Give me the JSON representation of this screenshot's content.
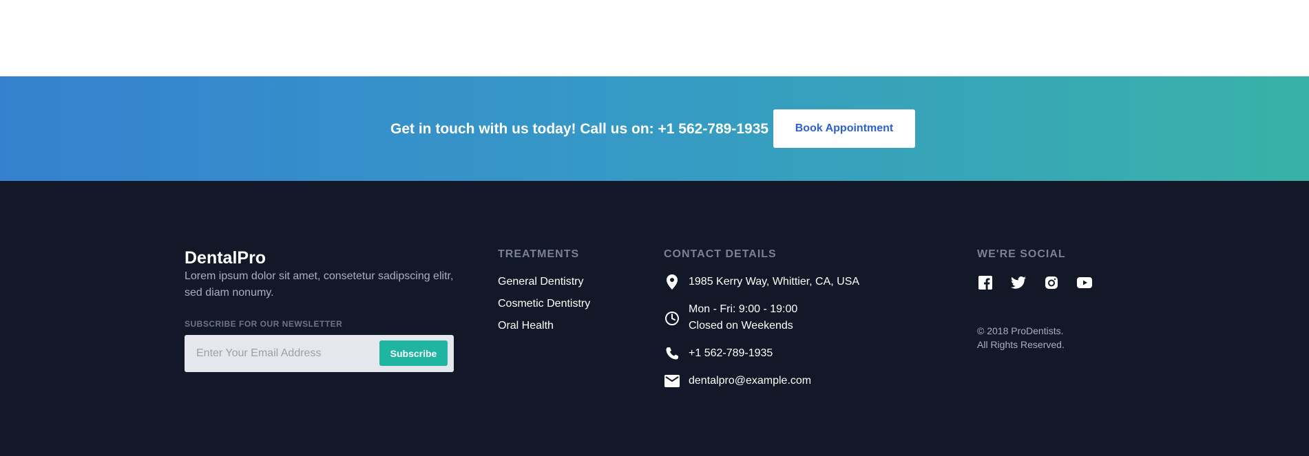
{
  "cta": {
    "text": "Get in touch with us today! Call us on: +1 562-789-1935",
    "button_label": "Book Appointment"
  },
  "brand": {
    "name": "DentalPro",
    "description": "Lorem ipsum dolor sit amet, consetetur sadipscing elitr, sed diam nonumy."
  },
  "newsletter": {
    "label": "SUBSCRIBE FOR OUR NEWSLETTER",
    "placeholder": "Enter Your Email Address",
    "button_label": "Subscribe"
  },
  "treatments": {
    "heading": "TREATMENTS",
    "items": [
      "General Dentistry",
      "Cosmetic Dentistry",
      "Oral Health"
    ]
  },
  "contact": {
    "heading": "CONTACT DETAILS",
    "address": "1985 Kerry Way, Whittier, CA, USA",
    "hours_line1": "Mon - Fri: 9:00 - 19:00",
    "hours_line2": "Closed on Weekends",
    "phone": "+1 562-789-1935",
    "email": "dentalpro@example.com",
    "icons": [
      "location-pin-icon",
      "clock-icon",
      "phone-icon",
      "envelope-icon"
    ]
  },
  "social": {
    "heading": "WE'RE SOCIAL",
    "icons": [
      "facebook-icon",
      "twitter-icon",
      "instagram-icon",
      "youtube-icon"
    ],
    "copyright_line1": "© 2018 ProDentists.",
    "copyright_line2": "All Rights Reserved."
  },
  "colors": {
    "gradient_start": "#3581cf",
    "gradient_end": "#38b2a8",
    "footer_bg": "#131829",
    "accent": "#1fb5a0",
    "button_text": "#2d5fd0"
  }
}
